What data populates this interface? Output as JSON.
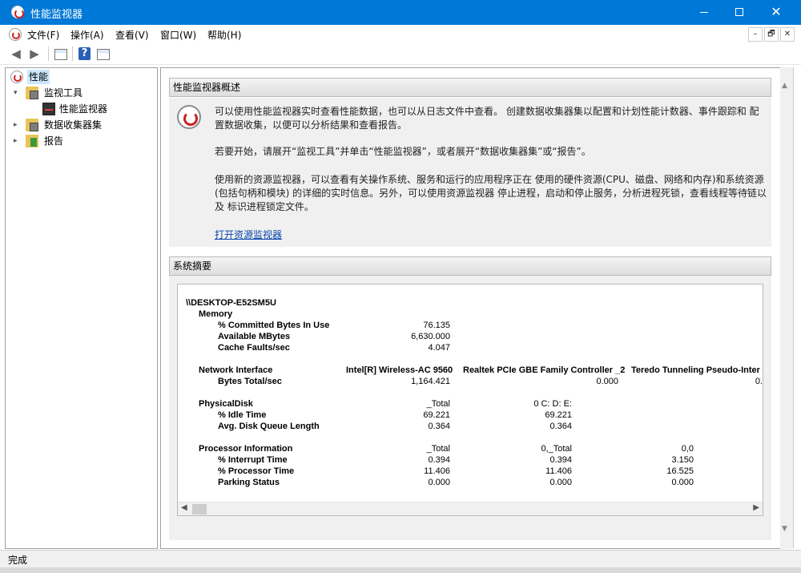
{
  "window": {
    "title": "性能监视器",
    "min_label": "",
    "max_label": "",
    "close_label": "✕"
  },
  "menu": {
    "items": [
      "文件(F)",
      "操作(A)",
      "查看(V)",
      "窗口(W)",
      "帮助(H)"
    ],
    "mdi_buttons": [
      "–",
      "🗗",
      "✕"
    ]
  },
  "toolbar": {
    "back_icon": "arrow-left-icon",
    "forward_icon": "arrow-right-icon",
    "console_icon": "console-tree-icon",
    "help_label": "?",
    "view_icon": "properties-icon"
  },
  "tree": {
    "items": [
      {
        "label": "性能",
        "icon": "performance-icon",
        "selected": true
      },
      {
        "label": "监视工具",
        "icon": "folder-icon",
        "expanded": true
      },
      {
        "label": "性能监视器",
        "icon": "monitor-chart-icon"
      },
      {
        "label": "数据收集器集",
        "icon": "folder-icon",
        "expanded": false
      },
      {
        "label": "报告",
        "icon": "report-icon",
        "expanded": false
      }
    ]
  },
  "overview": {
    "header": "性能监视器概述",
    "p1": "可以使用性能监视器实时查看性能数据，也可以从日志文件中查看。 创建数据收集器集以配置和计划性能计数器、事件跟踪和 配置数据收集，以便可以分析结果和查看报告。",
    "p2": "若要开始，请展开“监视工具”并单击“性能监视器”，或者展开“数据收集器集”或“报告”。",
    "p3": "使用新的资源监视器，可以查看有关操作系统、服务和运行的应用程序正在 使用的硬件资源(CPU、磁盘、网络和内存)和系统资源(包括句柄和模块) 的详细的实时信息。另外，可以使用资源监视器 停止进程，启动和停止服务，分析进程死锁，查看线程等待链以及 标识进程锁定文件。",
    "link": "打开资源监视器"
  },
  "summary": {
    "header": "系统摘要",
    "machine": "\\\\DESKTOP-E52SM5U",
    "memory": {
      "title": "Memory",
      "counters": [
        {
          "name": "% Committed Bytes In Use",
          "value": "76.135"
        },
        {
          "name": "Available MBytes",
          "value": "6,630.000"
        },
        {
          "name": "Cache Faults/sec",
          "value": "4.047"
        }
      ]
    },
    "network": {
      "title": "Network Interface",
      "instances": [
        "Intel[R] Wireless-AC 9560",
        "Realtek PCIe GBE Family Controller _2",
        "Teredo Tunneling Pseudo-Inter"
      ],
      "counter": "Bytes Total/sec",
      "values": [
        "1,164.421",
        "0.000",
        "0."
      ]
    },
    "disk": {
      "title": "PhysicalDisk",
      "instances": [
        "_Total",
        "0 C: D: E:"
      ],
      "rows": [
        {
          "name": "% Idle Time",
          "values": [
            "69.221",
            "69.221"
          ]
        },
        {
          "name": "Avg. Disk Queue Length",
          "values": [
            "0.364",
            "0.364"
          ]
        }
      ]
    },
    "processor": {
      "title": "Processor Information",
      "instances": [
        "_Total",
        "0,_Total",
        "0,0"
      ],
      "rows": [
        {
          "name": "% Interrupt Time",
          "values": [
            "0.394",
            "0.394",
            "3.150"
          ]
        },
        {
          "name": "% Processor Time",
          "values": [
            "11.406",
            "11.406",
            "16.525"
          ]
        },
        {
          "name": "Parking Status",
          "values": [
            "0.000",
            "0.000",
            "0.000"
          ]
        }
      ]
    }
  },
  "status": {
    "text": "完成"
  }
}
